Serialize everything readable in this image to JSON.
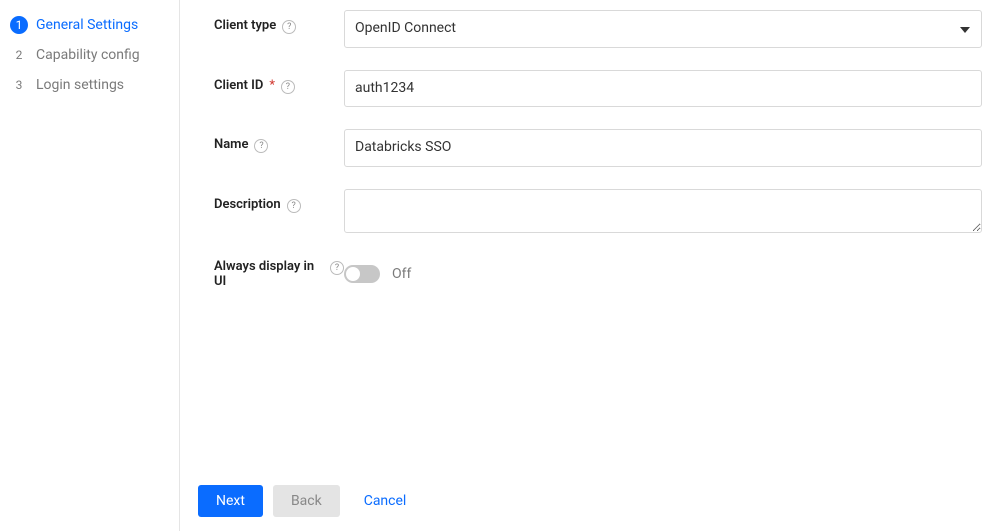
{
  "sidebar": {
    "steps": [
      {
        "num": "1",
        "label": "General Settings",
        "active": true
      },
      {
        "num": "2",
        "label": "Capability config",
        "active": false
      },
      {
        "num": "3",
        "label": "Login settings",
        "active": false
      }
    ]
  },
  "form": {
    "client_type": {
      "label": "Client type",
      "value": "OpenID Connect"
    },
    "client_id": {
      "label": "Client ID",
      "value": "auth1234",
      "required": true
    },
    "name": {
      "label": "Name",
      "value": "Databricks SSO"
    },
    "description": {
      "label": "Description",
      "value": ""
    },
    "always_display": {
      "label": "Always display in UI",
      "state_label": "Off",
      "on": false
    }
  },
  "footer": {
    "next": "Next",
    "back": "Back",
    "cancel": "Cancel"
  }
}
